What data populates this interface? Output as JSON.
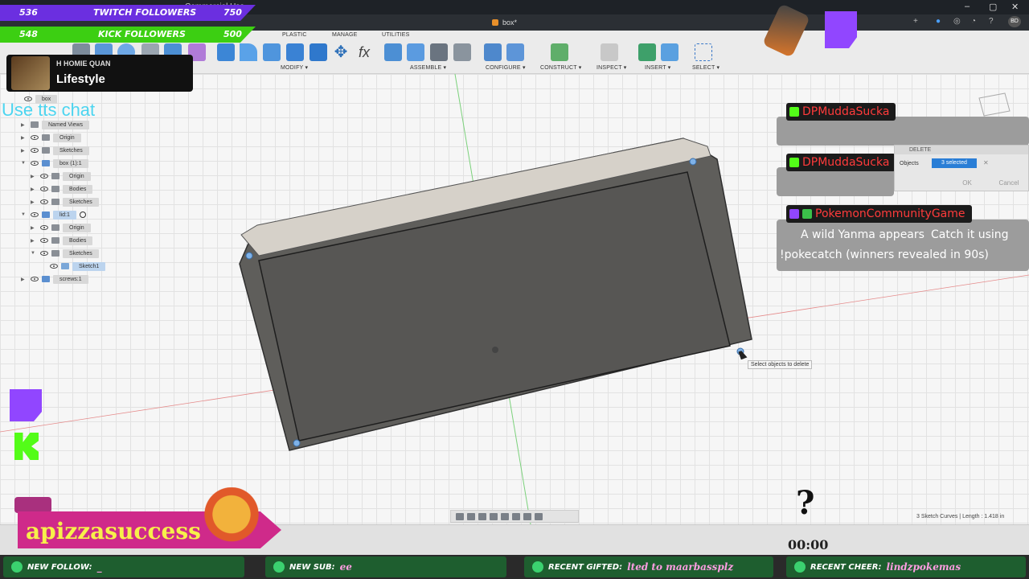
{
  "title_bar": {
    "title": "Commercial Use"
  },
  "document_tab": {
    "name": "box*"
  },
  "toolbar": {
    "tabs": [
      "PLASTIC",
      "MANAGE",
      "UTILITIES"
    ],
    "groups": [
      "MODIFY ▾",
      "ASSEMBLE ▾",
      "CONFIGURE ▾",
      "CONSTRUCT ▾",
      "INSPECT ▾",
      "INSERT ▾",
      "SELECT ▾"
    ]
  },
  "followers": {
    "twitch": {
      "current": "536",
      "label": "TWITCH FOLLOWERS",
      "goal": "750"
    },
    "kick": {
      "current": "548",
      "label": "KICK FOLLOWERS",
      "goal": "500"
    }
  },
  "streamer_card": {
    "line1": "H HOMIE QUAN",
    "line2": "Lifestyle"
  },
  "tts_prompt": "Use tts chat",
  "browser_tree": [
    {
      "label": "box"
    },
    {
      "label": "Named Views"
    },
    {
      "label": "Origin"
    },
    {
      "label": "Sketches"
    },
    {
      "label": "box (1):1"
    },
    {
      "label": "Origin"
    },
    {
      "label": "Bodies"
    },
    {
      "label": "Sketches"
    },
    {
      "label": "lid:1"
    },
    {
      "label": "Origin"
    },
    {
      "label": "Bodies"
    },
    {
      "label": "Sketches"
    },
    {
      "label": "Sketch1"
    },
    {
      "label": "screws:1"
    }
  ],
  "chat": [
    {
      "user": "DPMuddaSucka"
    },
    {
      "user": "DPMuddaSucka"
    },
    {
      "user": "PokemonCommunityGame",
      "line1a": "A wild Yanma appears",
      "line1b": "Catch it using",
      "line2": "!pokecatch (winners revealed in 90s)"
    }
  ],
  "delete_dialog": {
    "title": "DELETE",
    "objects_label": "Objects",
    "selection": "3 selected",
    "ok": "OK",
    "cancel": "Cancel"
  },
  "tooltip": "Select objects to delete",
  "status_text": "3 Sketch Curves | Length : 1.418 in",
  "timer": "00:00",
  "overlay_question": "?",
  "username_banner": "apizzasuccess",
  "alerts": {
    "new_follow": {
      "label": "NEW FOLLOW:",
      "value": "_"
    },
    "new_sub": {
      "label": "NEW SUB:",
      "value": "ee"
    },
    "recent_gifted": {
      "label": "RECENT GIFTED:",
      "value": "lted to maarbassplz"
    },
    "recent_cheer": {
      "label": "RECENT CHEER:",
      "value": "lindzpokemas"
    }
  },
  "colors": {
    "twitch": "#9146ff",
    "kick": "#53fc18",
    "accent_blue": "#2a7ed6",
    "body": "#5d5d5a",
    "body_top": "#cfcbc4"
  }
}
